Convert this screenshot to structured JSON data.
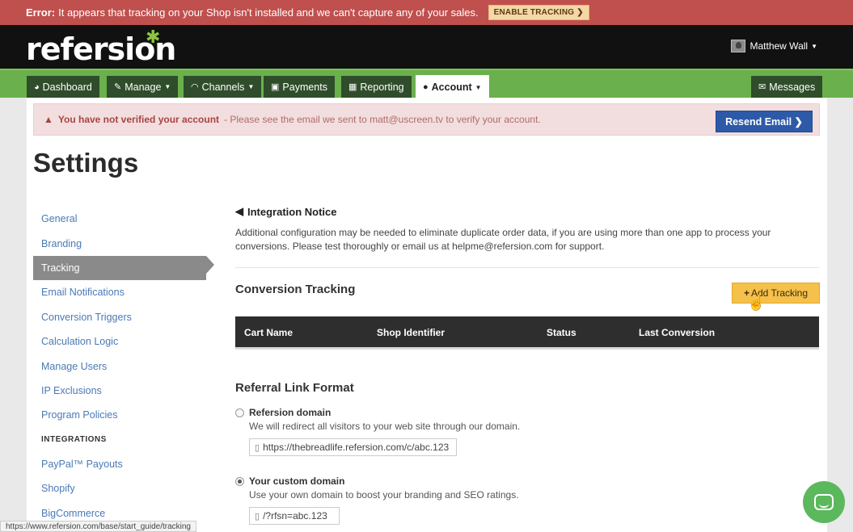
{
  "error_bar": {
    "label": "Error:",
    "message": "It appears that tracking on your Shop isn't installed and we can't capture any of your sales.",
    "button": "ENABLE TRACKING ❯"
  },
  "header": {
    "logo": "refersion",
    "user_name": "Matthew Wall"
  },
  "nav": {
    "items": [
      {
        "label": "Dashboard",
        "icon": "dashboard-icon"
      },
      {
        "label": "Manage",
        "icon": "edit-icon"
      },
      {
        "label": "Channels",
        "icon": "rss-icon"
      },
      {
        "label": "Payments",
        "icon": "money-icon"
      },
      {
        "label": "Reporting",
        "icon": "chart-icon"
      },
      {
        "label": "Account",
        "icon": "user-icon"
      },
      {
        "label": "Messages",
        "icon": "comments-icon"
      }
    ]
  },
  "verify": {
    "warning": "You have not verified your account",
    "message": "- Please see the email we sent to matt@uscreen.tv to verify your account.",
    "button": "Resend Email ❯"
  },
  "page_title": "Settings",
  "sidebar": {
    "items": [
      {
        "label": "General"
      },
      {
        "label": "Branding"
      },
      {
        "label": "Tracking"
      },
      {
        "label": "Email Notifications"
      },
      {
        "label": "Conversion Triggers"
      },
      {
        "label": "Calculation Logic"
      },
      {
        "label": "Manage Users"
      },
      {
        "label": "IP Exclusions"
      },
      {
        "label": "Program Policies"
      }
    ],
    "integrations_heading": "INTEGRATIONS",
    "integrations": [
      {
        "label": "PayPal™ Payouts"
      },
      {
        "label": "Shopify"
      },
      {
        "label": "BigCommerce"
      }
    ]
  },
  "notice": {
    "title": "Integration Notice",
    "body": "Additional configuration may be needed to eliminate duplicate order data, if you are using more than one app to process your conversions. Please test thoroughly or email us at helpme@refersion.com for support."
  },
  "conversion": {
    "title": "Conversion Tracking",
    "add_button": "Add Tracking",
    "columns": [
      "Cart Name",
      "Shop Identifier",
      "Status",
      "Last Conversion"
    ]
  },
  "referral": {
    "title": "Referral Link Format",
    "options": [
      {
        "label": "Refersion domain",
        "desc": "We will redirect all visitors to your web site through our domain.",
        "url": "https://thebreadlife.refersion.com/c/abc.123",
        "selected": false
      },
      {
        "label": "Your custom domain",
        "desc": "Use your own domain to boost your branding and SEO ratings.",
        "url": "/?rfsn=abc.123",
        "selected": true
      }
    ]
  },
  "status_url": "https://www.refersion.com/base/start_guide/tracking",
  "colors": {
    "error_bar": "#c0504d",
    "nav_green": "#6ab04c",
    "nav_item": "#2f4d2a",
    "resend_blue": "#2d5aa8",
    "add_button": "#f5c04b",
    "chat_green": "#5cb85c"
  }
}
